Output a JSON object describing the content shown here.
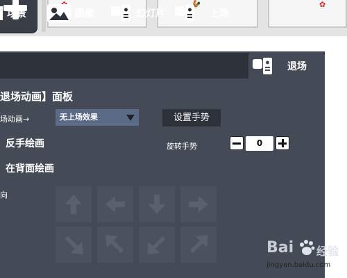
{
  "tabs": [
    {
      "label": "场景",
      "icon": "scene-icon"
    },
    {
      "label": "图像",
      "icon": "image-icon"
    },
    {
      "label": "幻灯片",
      "icon": "projector-icon"
    },
    {
      "label": "上场",
      "icon": "projector-icon"
    },
    {
      "label": "退场",
      "icon": "projector-icon",
      "active": true
    }
  ],
  "panel": {
    "title": "退场动画】面板",
    "effect_label": "场动画→",
    "effect_selected": "无上场效果",
    "gesture_button": "设置手势",
    "mirror_label": "反手绘画",
    "back_label": "在背面绘画",
    "rotate_label": "旋转手势",
    "rotate_value": "0",
    "direction_label": "向"
  },
  "thumbs": [
    {
      "glyph": "✿"
    },
    {
      "glyph": "🐓"
    },
    {
      "glyph": "✿"
    }
  ],
  "watermark": {
    "brand": "Bai",
    "brand_cn": "经验",
    "url": "jingyan.baidu.com"
  },
  "colors": {
    "panel": "#444b56",
    "tabbar": "#2d323a",
    "select": "#5b6b86"
  }
}
